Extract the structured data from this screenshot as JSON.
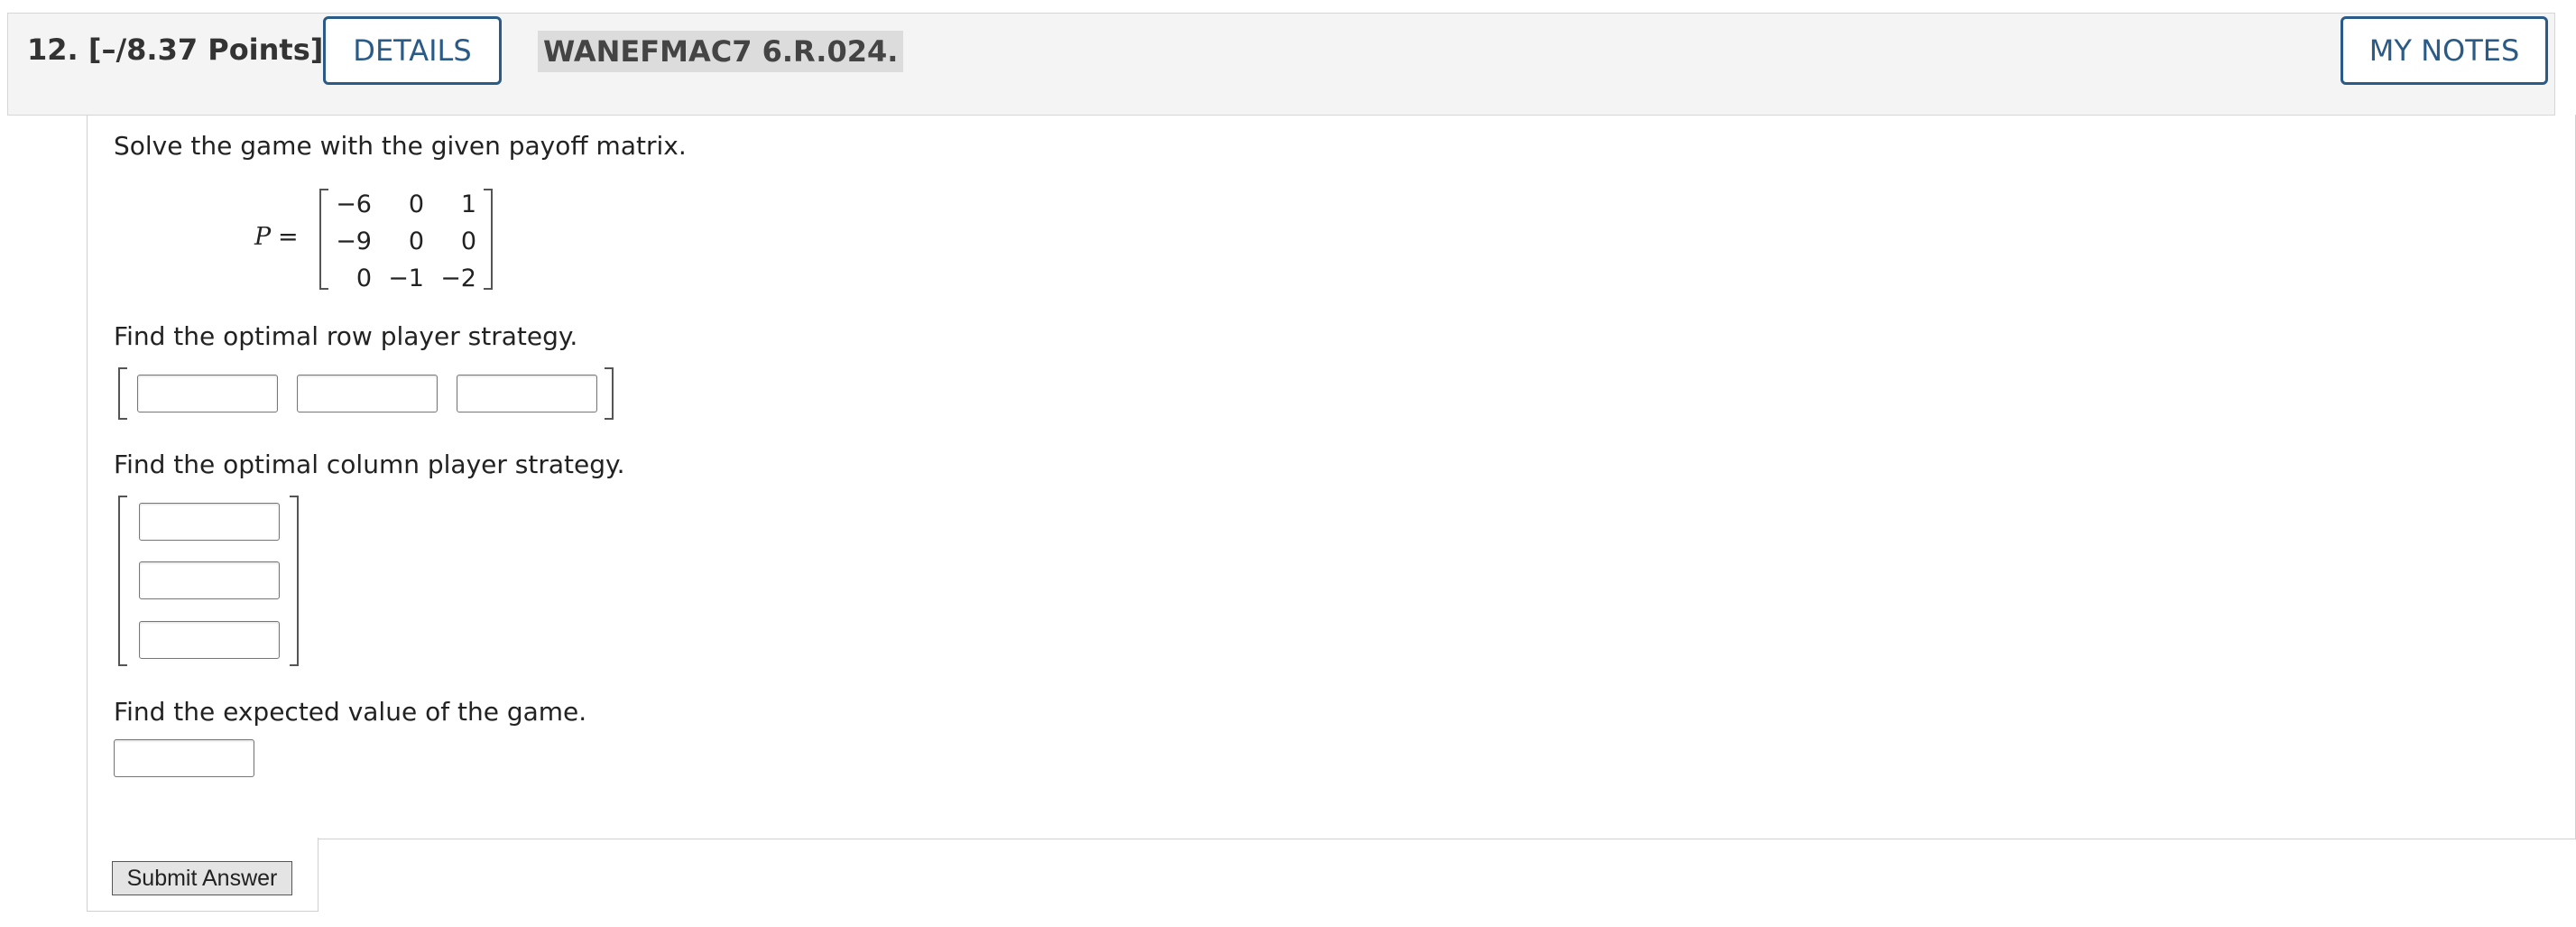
{
  "header": {
    "question_number": "12.",
    "points": "[–/8.37 Points]",
    "details_label": "DETAILS",
    "question_code": "WANEFMAC7 6.R.024.",
    "my_notes_label": "MY NOTES"
  },
  "problem": {
    "prompt": "Solve the game with the given payoff matrix.",
    "matrix_label": "P",
    "matrix_equals": "=",
    "matrix": [
      [
        "−6",
        "0",
        "1"
      ],
      [
        "−9",
        "0",
        "0"
      ],
      [
        "0",
        "−1",
        "−2"
      ]
    ],
    "q_row": "Find the optimal row player strategy.",
    "q_col": "Find the optimal column player strategy.",
    "q_value": "Find the expected value of the game."
  },
  "answers": {
    "row": [
      "",
      "",
      ""
    ],
    "col": [
      "",
      "",
      ""
    ],
    "value": ""
  },
  "actions": {
    "submit_label": "Submit Answer"
  }
}
